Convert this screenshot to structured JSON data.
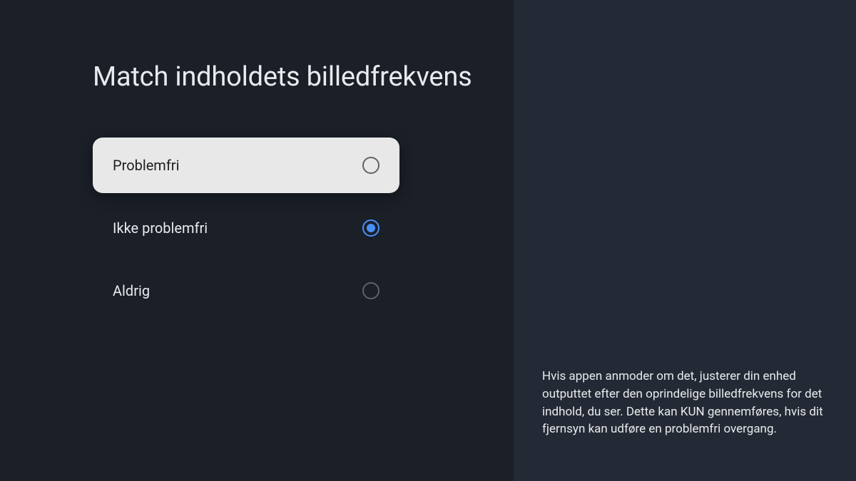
{
  "title": "Match indholdets billedfrekvens",
  "options": [
    {
      "label": "Problemfri",
      "selected": false,
      "focused": true
    },
    {
      "label": "Ikke problemfri",
      "selected": true,
      "focused": false
    },
    {
      "label": "Aldrig",
      "selected": false,
      "focused": false
    }
  ],
  "description": "Hvis appen anmoder om det, justerer din enhed outputtet efter den oprindelige billedfrekvens for det indhold, du ser. Dette kan KUN gennemføres, hvis dit fjernsyn kan udføre en problemfri overgang."
}
